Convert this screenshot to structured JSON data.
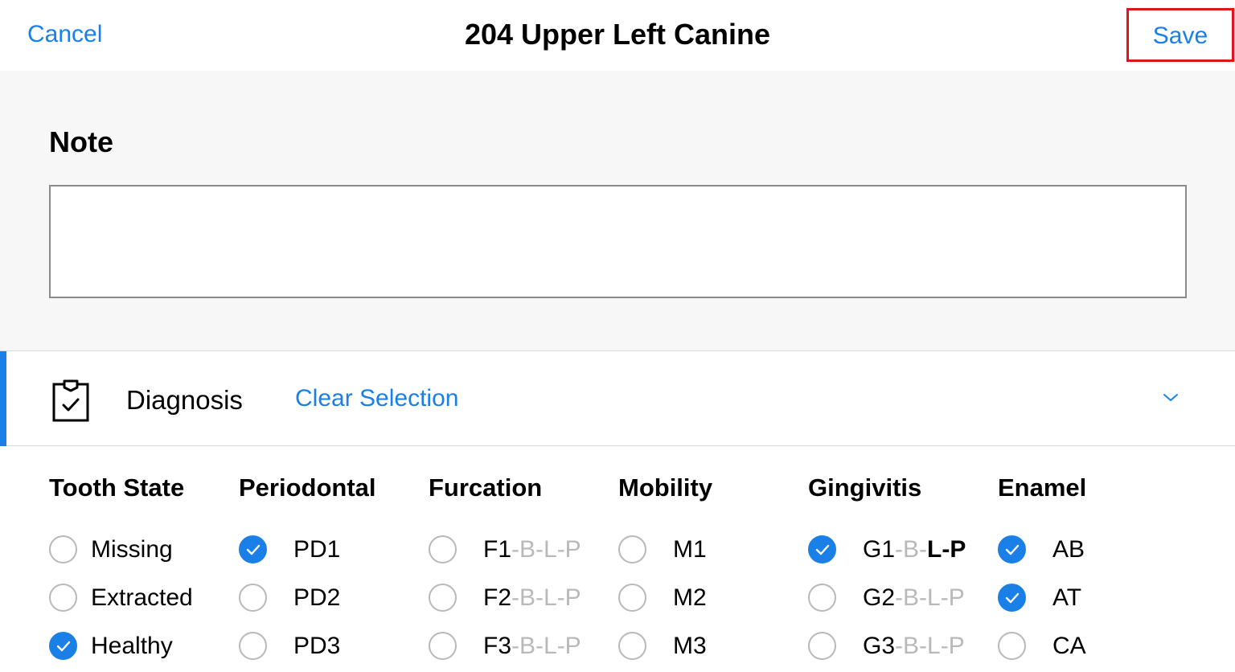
{
  "navbar": {
    "cancel_label": "Cancel",
    "title": "204 Upper Left Canine",
    "save_label": "Save"
  },
  "note": {
    "heading": "Note",
    "value": "",
    "placeholder": ""
  },
  "diagnosis": {
    "label": "Diagnosis",
    "clear_label": "Clear Selection",
    "icon": "clipboard-check-icon",
    "expand_icon": "chevron-down-icon",
    "accent_color": "#1a7fe6"
  },
  "columns": [
    {
      "title": "Tooth State",
      "options": [
        {
          "label": "Missing",
          "checked": false
        },
        {
          "label": "Extracted",
          "checked": false
        },
        {
          "label": "Healthy",
          "checked": true
        }
      ]
    },
    {
      "title": "Periodontal",
      "options": [
        {
          "label": "PD1",
          "checked": true
        },
        {
          "label": "PD2",
          "checked": false
        },
        {
          "label": "PD3",
          "checked": false
        }
      ]
    },
    {
      "title": "Furcation",
      "options": [
        {
          "label": "F1",
          "suffix": "-B-L-P",
          "checked": false
        },
        {
          "label": "F2",
          "suffix": "-B-L-P",
          "checked": false
        },
        {
          "label": "F3",
          "suffix": "-B-L-P",
          "checked": false
        }
      ]
    },
    {
      "title": "Mobility",
      "options": [
        {
          "label": "M1",
          "checked": false
        },
        {
          "label": "M2",
          "checked": false
        },
        {
          "label": "M3",
          "checked": false
        }
      ]
    },
    {
      "title": "Gingivitis",
      "options": [
        {
          "label": "G1",
          "suffix": "-B-",
          "suffix_bold": "L-P",
          "checked": true
        },
        {
          "label": "G2",
          "suffix": "-B-L-P",
          "checked": false
        },
        {
          "label": "G3",
          "suffix": "-B-L-P",
          "checked": false
        }
      ]
    },
    {
      "title": "Enamel",
      "options": [
        {
          "label": "AB",
          "checked": true
        },
        {
          "label": "AT",
          "checked": true
        },
        {
          "label": "CA",
          "checked": false
        }
      ]
    }
  ],
  "colors": {
    "link": "#1a7fe6",
    "checked": "#1a7fe6",
    "save_highlight": "#e0141e",
    "muted_suffix": "#b9b9b9"
  }
}
